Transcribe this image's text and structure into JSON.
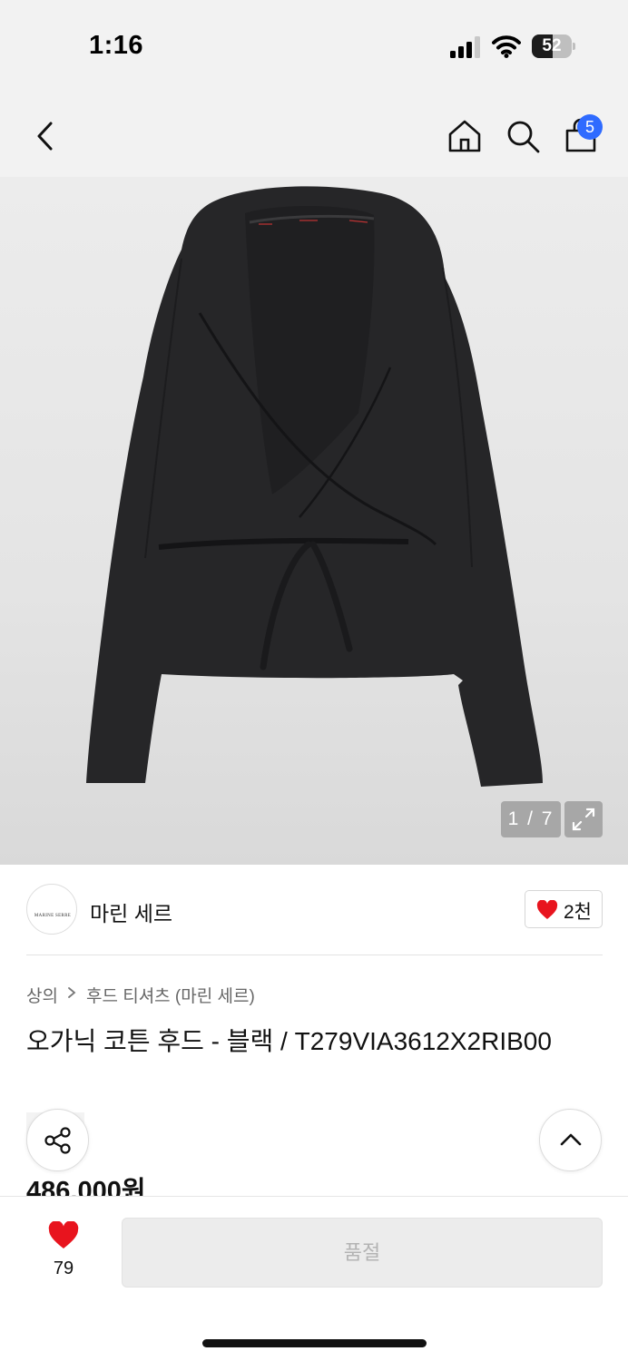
{
  "status_bar": {
    "time": "1:16",
    "battery_level": "52",
    "battery_fraction": 0.52
  },
  "nav": {
    "back_icon": "chevron-left-icon",
    "home_icon": "home-icon",
    "search_icon": "search-icon",
    "bag_icon": "shopping-bag-icon",
    "bag_badge": "5",
    "badge_color": "#2f6bff"
  },
  "gallery": {
    "counter": "1 / 7",
    "expand_icon": "expand-icon"
  },
  "brand": {
    "name": "마린 세르",
    "logo_text": "MARINE SERRE",
    "likes": "2천"
  },
  "breadcrumb": {
    "category": "상의",
    "subcategory": "후드 티셔츠 (마린 세르)"
  },
  "product": {
    "title": "오가닉 코튼 후드 - 블랙 / T279VIA3612X2RIB00",
    "price": "486,000원"
  },
  "bottom_bar": {
    "wish_count": "79",
    "sold_out_label": "품절",
    "heart_color": "#e8141e"
  }
}
